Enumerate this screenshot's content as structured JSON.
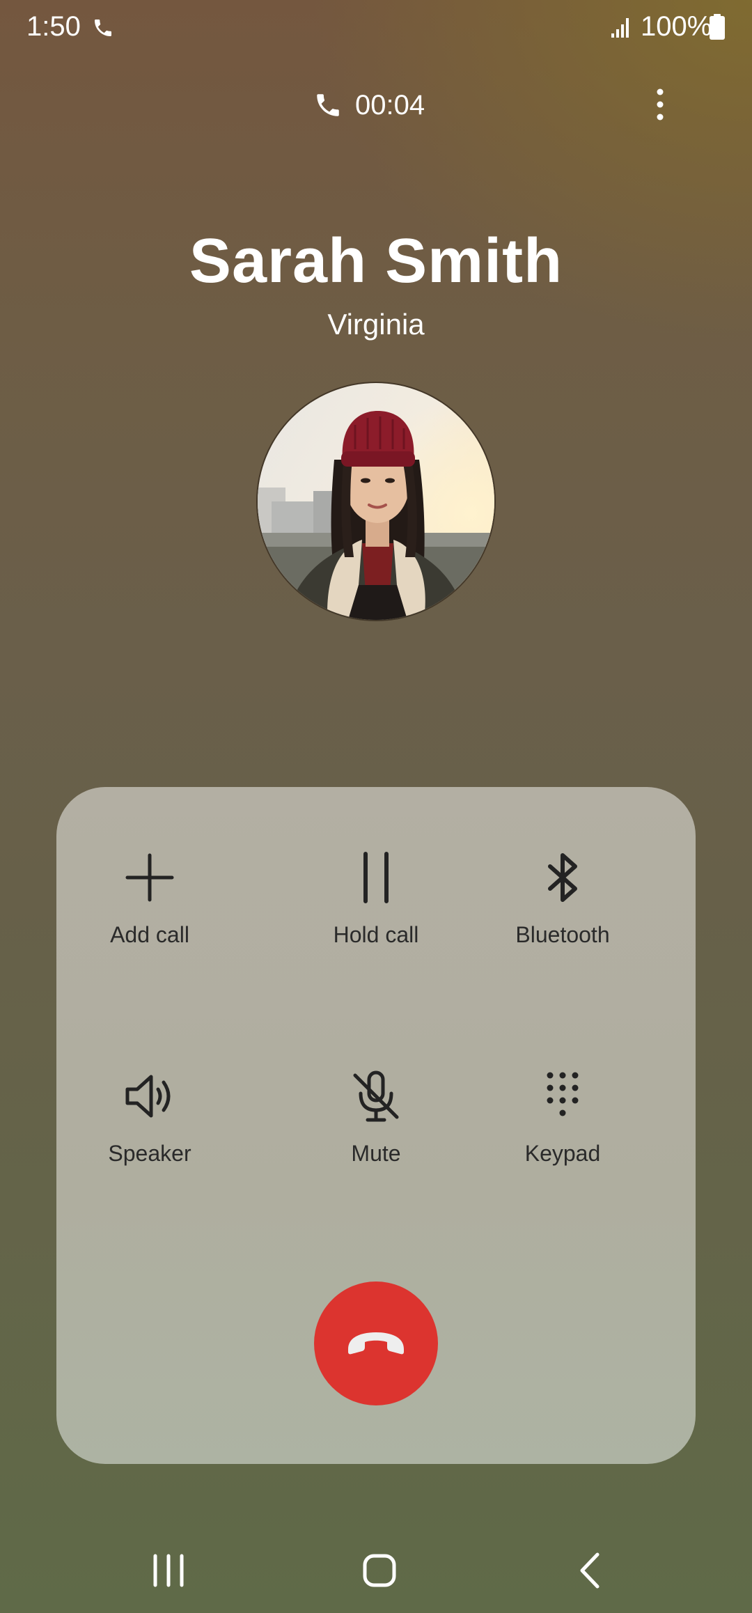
{
  "status_bar": {
    "time": "1:50",
    "battery": "100%",
    "icons": [
      "call-icon",
      "signal-icon",
      "battery-icon"
    ]
  },
  "call": {
    "timer": "00:04",
    "contact_name": "Sarah Smith",
    "contact_location": "Virginia"
  },
  "controls": [
    {
      "label": "Add call",
      "icon": "plus-icon"
    },
    {
      "label": "Hold call",
      "icon": "pause-icon"
    },
    {
      "label": "Bluetooth",
      "icon": "bluetooth-icon"
    },
    {
      "label": "Speaker",
      "icon": "speaker-icon"
    },
    {
      "label": "Mute",
      "icon": "mic-off-icon"
    },
    {
      "label": "Keypad",
      "icon": "keypad-icon"
    }
  ],
  "colors": {
    "end_call": "#dc342f",
    "panel": "#b3afa3",
    "icon_dark": "#232323"
  },
  "nav_bar": {
    "icons": [
      "recents-icon",
      "home-icon",
      "back-icon"
    ]
  }
}
